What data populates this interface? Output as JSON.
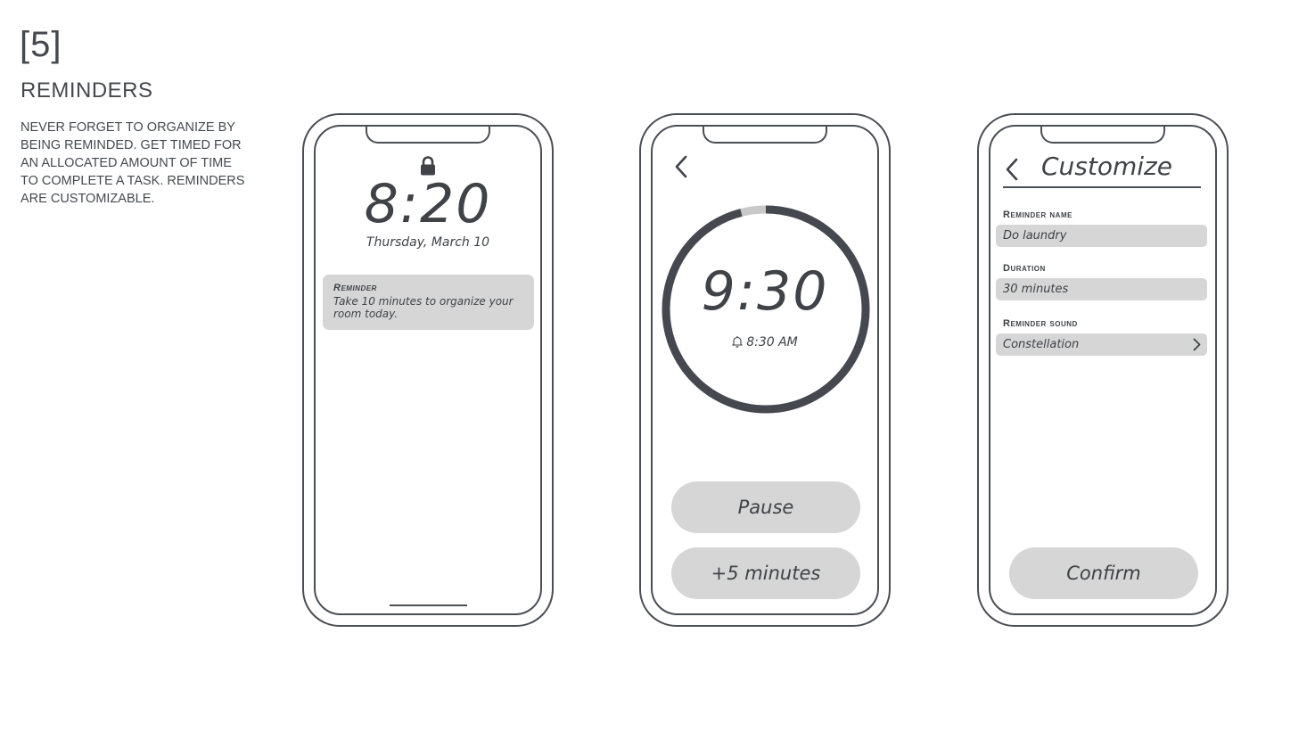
{
  "section": {
    "number": "[5]",
    "title": "REMINDERS",
    "description": "NEVER FORGET TO ORGANIZE BY BEING REMINDED. GET TIMED FOR AN ALLOCATED AMOUNT OF TIME TO COMPLETE A TASK. REMINDERS ARE CUSTOMIZABLE."
  },
  "lock_screen": {
    "lock_icon": "lock-icon",
    "time": "8:20",
    "date": "Thursday, March 10",
    "notification": {
      "title": "Reminder",
      "body": "Take 10 minutes to organize your room today."
    }
  },
  "timer_screen": {
    "back_icon": "chevron-left-icon",
    "time": "9:30",
    "progress": 0.04,
    "alarm_icon": "bell-icon",
    "alarm_time": "8:30 AM",
    "pause_label": "Pause",
    "add_label": "+5 minutes"
  },
  "customize_screen": {
    "back_icon": "chevron-left-icon",
    "title": "Customize",
    "fields": [
      {
        "label": "Reminder name",
        "value": "Do laundry"
      },
      {
        "label": "Duration",
        "value": "30 minutes"
      },
      {
        "label": "Reminder sound",
        "value": "Constellation"
      }
    ],
    "confirm_label": "Confirm"
  },
  "colors": {
    "stroke": "#4a4e55",
    "fill": "#d6d6d6",
    "text": "#3f4247"
  }
}
